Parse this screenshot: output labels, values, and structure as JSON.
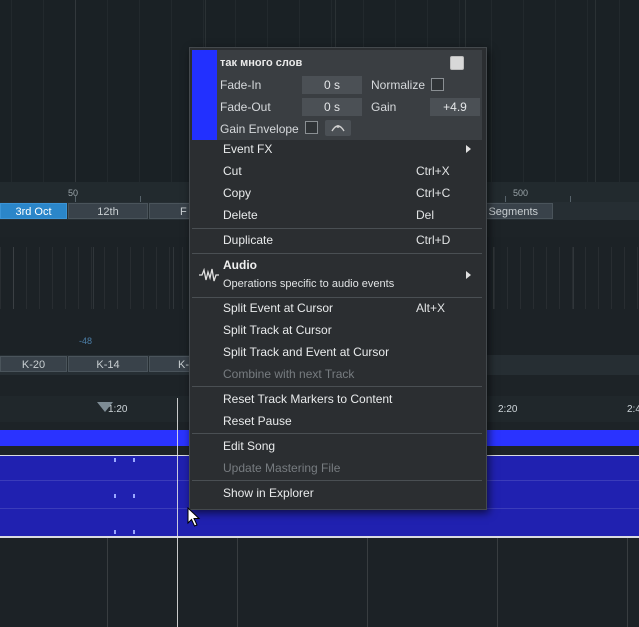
{
  "background": {
    "ruler_marks": [
      "50",
      "500"
    ],
    "date_pills": [
      "3rd Oct",
      "12th",
      "F",
      "Segments"
    ],
    "meter_label": "-48",
    "meter_pills": [
      "K-20",
      "K-14",
      "K-"
    ],
    "timeline_labels": [
      "1:20",
      "2:20",
      "2:4"
    ]
  },
  "event_header": {
    "name": "так много слов",
    "fade_in_label": "Fade-In",
    "fade_in_value": "0 s",
    "normalize_label": "Normalize",
    "fade_out_label": "Fade-Out",
    "fade_out_value": "0 s",
    "gain_label": "Gain",
    "gain_value": "+4.9",
    "gain_envelope_label": "Gain Envelope",
    "color": "#2230ff"
  },
  "menu": {
    "event_fx": "Event FX",
    "cut": "Cut",
    "cut_shortcut": "Ctrl+X",
    "copy": "Copy",
    "copy_shortcut": "Ctrl+C",
    "delete": "Delete",
    "delete_shortcut": "Del",
    "duplicate": "Duplicate",
    "duplicate_shortcut": "Ctrl+D",
    "audio_title": "Audio",
    "audio_desc": "Operations specific to audio events",
    "split_event": "Split Event at Cursor",
    "split_event_shortcut": "Alt+X",
    "split_track": "Split Track at Cursor",
    "split_track_event": "Split Track and Event at Cursor",
    "combine": "Combine with next Track",
    "reset_markers": "Reset Track Markers to Content",
    "reset_pause": "Reset Pause",
    "edit_song": "Edit Song",
    "update_mastering": "Update Mastering File",
    "show_explorer": "Show in Explorer"
  }
}
